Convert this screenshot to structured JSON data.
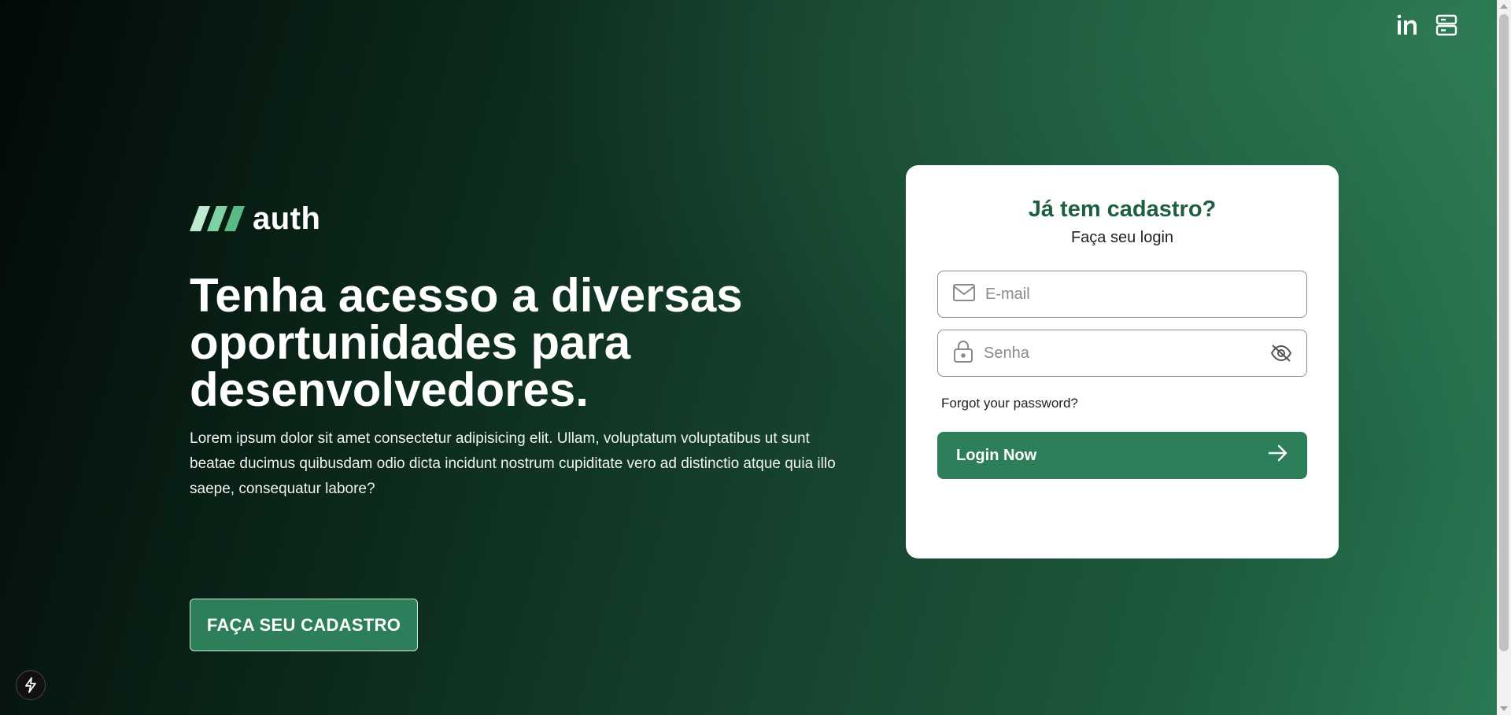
{
  "topbar": {
    "linkedin_icon": "linkedin-icon",
    "server_icon": "server-icon"
  },
  "brand": {
    "logo_text": "auth",
    "logo_stripe_colors": [
      "#bfe9d0",
      "#7fd1a4",
      "#5aba86"
    ]
  },
  "hero": {
    "headline": "Tenha acesso a diversas oportunidades para desenvolvedores.",
    "description": "Lorem ipsum dolor sit amet consectetur adipisicing elit. Ullam, voluptatum voluptatibus ut sunt beatae ducimus quibusdam odio dicta incidunt nostrum cupiditate vero ad distinctio atque quia illo saepe, consequatur labore?",
    "cta_label": "FAÇA SEU CADASTRO"
  },
  "login": {
    "title": "Já tem cadastro?",
    "subtitle": "Faça seu login",
    "email_placeholder": "E-mail",
    "email_value": "",
    "password_placeholder": "Senha",
    "password_value": "",
    "forgot_label": "Forgot your password?",
    "submit_label": "Login Now"
  },
  "colors": {
    "accent": "#2c7f58",
    "title": "#1f5f41",
    "background_dark": "#020a06",
    "background_light": "#2a7a54"
  }
}
